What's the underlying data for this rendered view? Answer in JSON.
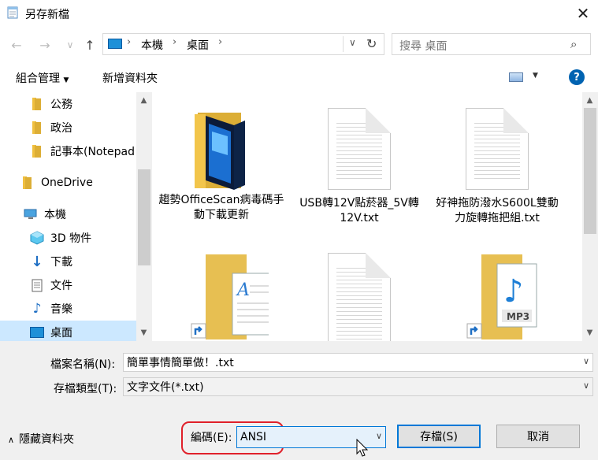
{
  "window": {
    "title": "另存新檔",
    "close": "✕"
  },
  "nav": {
    "back": "←",
    "forward": "→",
    "recent": "∨",
    "up": "↑",
    "breadcrumb": [
      "本機",
      "桌面"
    ],
    "separator": "›",
    "search_placeholder": "搜尋 桌面"
  },
  "toolbar": {
    "organize": "組合管理",
    "new_folder": "新增資料夾",
    "help": "?"
  },
  "sidebar": {
    "items": [
      {
        "label": "公務",
        "icon": "folder-icon"
      },
      {
        "label": "政治",
        "icon": "folder-icon"
      },
      {
        "label": "記事本(Notepad",
        "icon": "folder-icon"
      },
      {
        "label": "OneDrive",
        "icon": "onedrive-icon"
      },
      {
        "label": "本機",
        "icon": "computer-icon"
      },
      {
        "label": "3D 物件",
        "icon": "3d-objects-icon"
      },
      {
        "label": "下載",
        "icon": "download-icon"
      },
      {
        "label": "文件",
        "icon": "documents-icon"
      },
      {
        "label": "音樂",
        "icon": "music-icon"
      },
      {
        "label": "桌面",
        "icon": "desktop-icon"
      }
    ],
    "selected": "桌面"
  },
  "files": [
    {
      "name": "趨勢OfficeScan病毒碼手動下載更新",
      "icon": "folder-icon"
    },
    {
      "name": "USB轉12V點菸器_5V轉12V.txt",
      "icon": "text-file-icon"
    },
    {
      "name": "好神拖防潑水S600L雙動力旋轉拖把組.txt",
      "icon": "text-file-icon"
    },
    {
      "name": "",
      "icon": "document-shortcut-icon"
    },
    {
      "name": "",
      "icon": "text-file-icon"
    },
    {
      "name": "",
      "icon": "mp3-shortcut-icon",
      "badge": "MP3"
    }
  ],
  "form": {
    "filename_label": "檔案名稱(N):",
    "filename_value": "簡單事情簡單做！.txt",
    "filetype_label": "存檔類型(T):",
    "filetype_value": "文字文件(*.txt)",
    "encoding_label": "編碼(E):",
    "encoding_value": "ANSI",
    "hide_folders": "隱藏資料夾",
    "save": "存檔(S)",
    "cancel": "取消"
  },
  "colors": {
    "highlight": "#e0202a",
    "accent": "#0063b1",
    "selected_bg": "#cce8ff"
  }
}
